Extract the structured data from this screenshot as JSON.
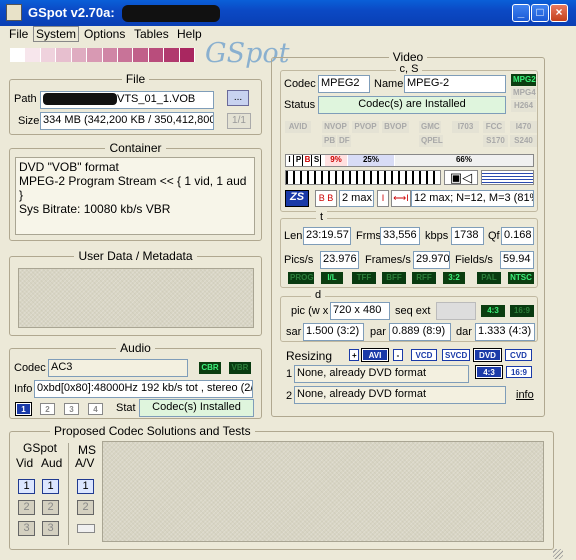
{
  "window": {
    "title": "GSpot v2.70a:"
  },
  "menu": {
    "file": "File",
    "system": "System",
    "options": "Options",
    "tables": "Tables",
    "help": "Help"
  },
  "logo": "GSpot",
  "file": {
    "legend": "File",
    "path_label": "Path",
    "path_value": "VTS_01_1.VOB",
    "browse": "...",
    "size_label": "Size",
    "size_value": "334 MB (342,200 KB / 350,412,800",
    "part": "1/1"
  },
  "container": {
    "legend": "Container",
    "lines": [
      "DVD \"VOB\" format",
      "MPEG-2 Program Stream << { 1 vid, 1 aud }",
      "Sys Bitrate: 10080 kb/s VBR"
    ]
  },
  "userdata": {
    "legend": "User Data / Metadata"
  },
  "audio": {
    "legend": "Audio",
    "codec_label": "Codec",
    "codec_value": "AC3",
    "cbr": "CBR",
    "vbr": "VBR",
    "info_label": "Info",
    "info_value": "0xbd[0x80]:48000Hz  192 kb/s tot , stereo (2/",
    "stream_btns": [
      "1",
      "2",
      "3",
      "4"
    ],
    "stat_label": "Stat",
    "stat_value": "Codec(s) Installed"
  },
  "video": {
    "legend": "Video",
    "cs": "c, S",
    "codec_label": "Codec",
    "codec_value": "MPEG2",
    "name_label": "Name",
    "name_value": "MPEG-2",
    "status_label": "Status",
    "status_value": "Codec(s) are Installed",
    "fmt_right": [
      "MPG2",
      "MPG4",
      "H264"
    ],
    "fmt_a": [
      "AVID",
      "NVOP",
      "PVOP",
      "BVOP",
      "GMC",
      "I703",
      "FCC",
      "I470"
    ],
    "fmt_b": [
      "PB",
      "DF",
      "QPEL",
      "S170",
      "S240"
    ],
    "ipbs": [
      "I",
      "P",
      "B",
      "S"
    ],
    "pct1": "9%",
    "pct2": "25%",
    "pct3": "66%",
    "gop_max": "2 max",
    "gop_info": "12 max; N=12, M=3 (81%",
    "t": "t",
    "len_label": "Len",
    "len_value": "23:19.57",
    "frms_label": "Frms",
    "frms_value": "33,556",
    "kbps_label": "kbps",
    "kbps_value": "1738",
    "qf_label": "Qf",
    "qf_value": "0.168",
    "pics_label": "Pics/s",
    "pics_value": "23.976",
    "frames_label": "Frames/s",
    "frames_value": "29.970",
    "fields_label": "Fields/s",
    "fields_value": "59.94",
    "scan": [
      "PROG",
      "I/L",
      "TFF",
      "BFF",
      "RFF",
      "3:2",
      "PAL",
      "NTSC"
    ],
    "d": "d",
    "pic_label": "pic (w x",
    "pic_value": "720 x 480",
    "seqext_label": "seq ext",
    "ar43": "4:3",
    "ar169": "16:9",
    "sar_label": "sar",
    "sar_value": "1.500 (3:2)",
    "par_label": "par",
    "par_value": "0.889 (8:9)",
    "dar_label": "dar",
    "dar_value": "1.333 (4:3)",
    "resizing_label": "Resizing",
    "resize_btns": [
      "AVI",
      "VCD",
      "SVCD",
      "DVD",
      "CVD"
    ],
    "resize1_num": "1",
    "resize1_value": "None, already DVD format",
    "resize2_num": "2",
    "resize2_value": "None, already DVD format",
    "ar_btn1": "4:3",
    "ar_btn2": "16:9",
    "info_link": "info"
  },
  "proposed": {
    "legend": "Proposed Codec Solutions and Tests",
    "gspot": "GSpot",
    "vid": "Vid",
    "aud": "Aud",
    "ms": "MS",
    "av": "A/V",
    "nums": [
      "1",
      "2",
      "3"
    ]
  },
  "colors": {
    "strip": [
      "#ffffff",
      "#f7e6ec",
      "#efd2dd",
      "#e7bfcf",
      "#dfacc1",
      "#d899b3",
      "#d086a6",
      "#c87398",
      "#c1608a",
      "#b94d7c",
      "#b13a6e",
      "#a92760"
    ]
  }
}
